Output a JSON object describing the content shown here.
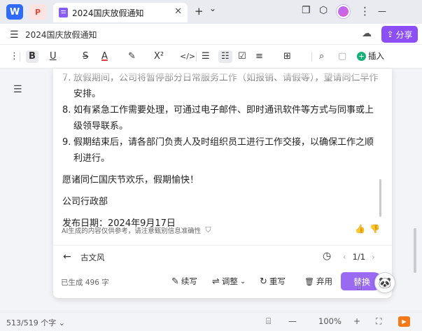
{
  "tabbar": {
    "app_icon_label": "W",
    "pdf_icon_label": "P",
    "tab_title": "2024国庆放假通知",
    "close_glyph": "✕",
    "new_tab_glyph": "+",
    "dropdown_glyph": "⌄",
    "window_glyph": "❐",
    "cube_glyph": "⬡",
    "more_glyph": "⋮",
    "minimize_glyph": "—"
  },
  "titlebar": {
    "menu_glyph": "☰",
    "doc_title": "2024国庆放假通知",
    "cloud_glyph": "☁",
    "share_label": "分享"
  },
  "toolbar": {
    "items": [
      {
        "name": "more-menu-icon",
        "glyph": "⋮"
      },
      {
        "name": "bold-button",
        "glyph": "B"
      },
      {
        "name": "underline-button",
        "glyph": "U"
      },
      {
        "name": "strikethrough-button",
        "glyph": "S̶"
      },
      {
        "name": "font-color-button",
        "glyph": "A"
      },
      {
        "name": "highlight-button",
        "glyph": "✎"
      },
      {
        "name": "superscript-button",
        "glyph": "X²"
      },
      {
        "name": "code-button",
        "glyph": "</>"
      },
      {
        "name": "bullet-list-button",
        "glyph": "☰"
      },
      {
        "name": "ordered-list-button",
        "glyph": "☷"
      },
      {
        "name": "checkbox-button",
        "glyph": "☑"
      },
      {
        "name": "align-button",
        "glyph": "≡"
      },
      {
        "name": "table-button",
        "glyph": "⊞"
      },
      {
        "name": "search-icon",
        "glyph": "⌕"
      },
      {
        "name": "comment-icon",
        "glyph": "▢"
      }
    ],
    "insert_label": "插入",
    "insert_glyph": "+"
  },
  "document": {
    "toc_glyph": "☰",
    "list_items": [
      {
        "num": "7.",
        "text": "放假期间，公司将暂停部分日常服务工作（如报销、请假等），望请同仁早作安排。"
      },
      {
        "num": "8.",
        "text": "如有紧急工作需要处理，可通过电子邮件、即时通讯软件等方式与同事或上级领导联系。"
      },
      {
        "num": "9.",
        "text": "假期结束后，请各部门负责人及时组织员工进行工作交接，以确保工作之顺利进行。"
      }
    ],
    "closing": "愿诸同仁国庆节欢乐，假期愉快！",
    "signature": "公司行政部",
    "date_line": "发布日期：2024年9月17日"
  },
  "ai_panel": {
    "disclaimer": "AI生成的内容仅供参考，请注意甄别信息准确性",
    "shield_glyph": "⛉",
    "like_glyph": "👍",
    "dislike_glyph": "👎",
    "back_glyph": "←",
    "style_name": "古文风",
    "history_glyph": "◷",
    "prev_glyph": "‹",
    "page_indicator": "1/1",
    "next_glyph": "›",
    "generated_count": "已生成 496 字",
    "continue_label": "续写",
    "continue_glyph": "✎",
    "adjust_label": "调整",
    "adjust_glyph": "⇌",
    "adjust_caret": "⌄",
    "rewrite_label": "重写",
    "rewrite_glyph": "↻",
    "discard_label": "弃用",
    "discard_glyph": "🗑",
    "replace_label": "替换",
    "cursor_glyph": "☝",
    "mascot_glyph": "🐼"
  },
  "statusbar": {
    "word_count": "513/519 个字 ⌄",
    "layout_glyph": "⌸",
    "zoom_out_glyph": "—",
    "zoom_level": "100%",
    "zoom_in_glyph": "+",
    "fit_glyph": "⛶",
    "app_badge": "▶"
  }
}
